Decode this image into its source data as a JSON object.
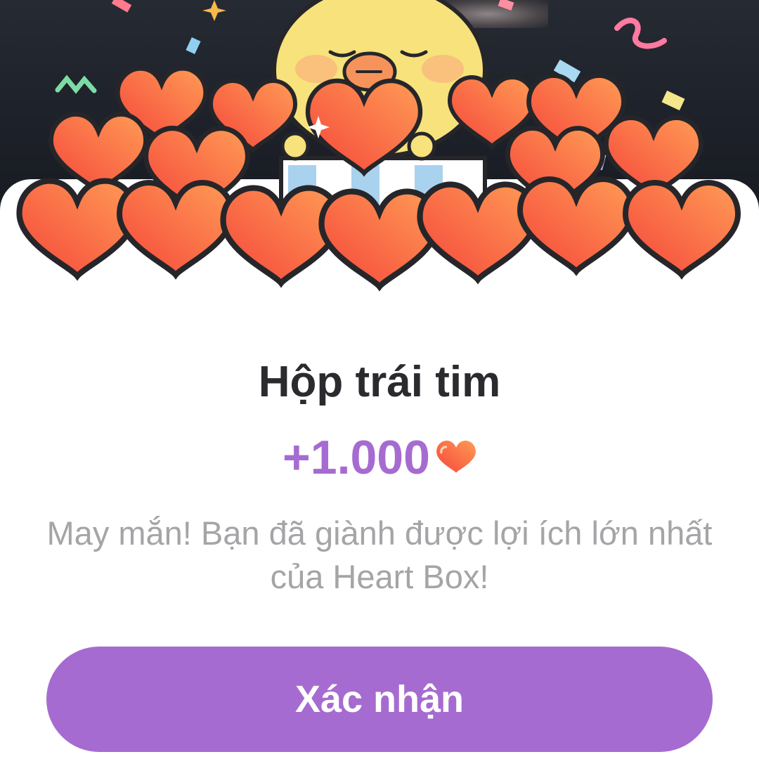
{
  "reward": {
    "title": "Hộp trái tim",
    "amount": "+1.000",
    "description": "May mắn! Bạn đã giành được lợi ích lớn nhất của Heart Box!",
    "confirm_label": "Xác nhận"
  },
  "colors": {
    "accent": "#a66bd0",
    "title": "#2b2b2f",
    "description": "#a5a5a8",
    "heart_light": "#ff9b55",
    "heart_dark": "#f5463b",
    "chick": "#f7e27c"
  },
  "icons": [
    "heart-icon",
    "chick-mascot",
    "gift-box",
    "confetti"
  ]
}
